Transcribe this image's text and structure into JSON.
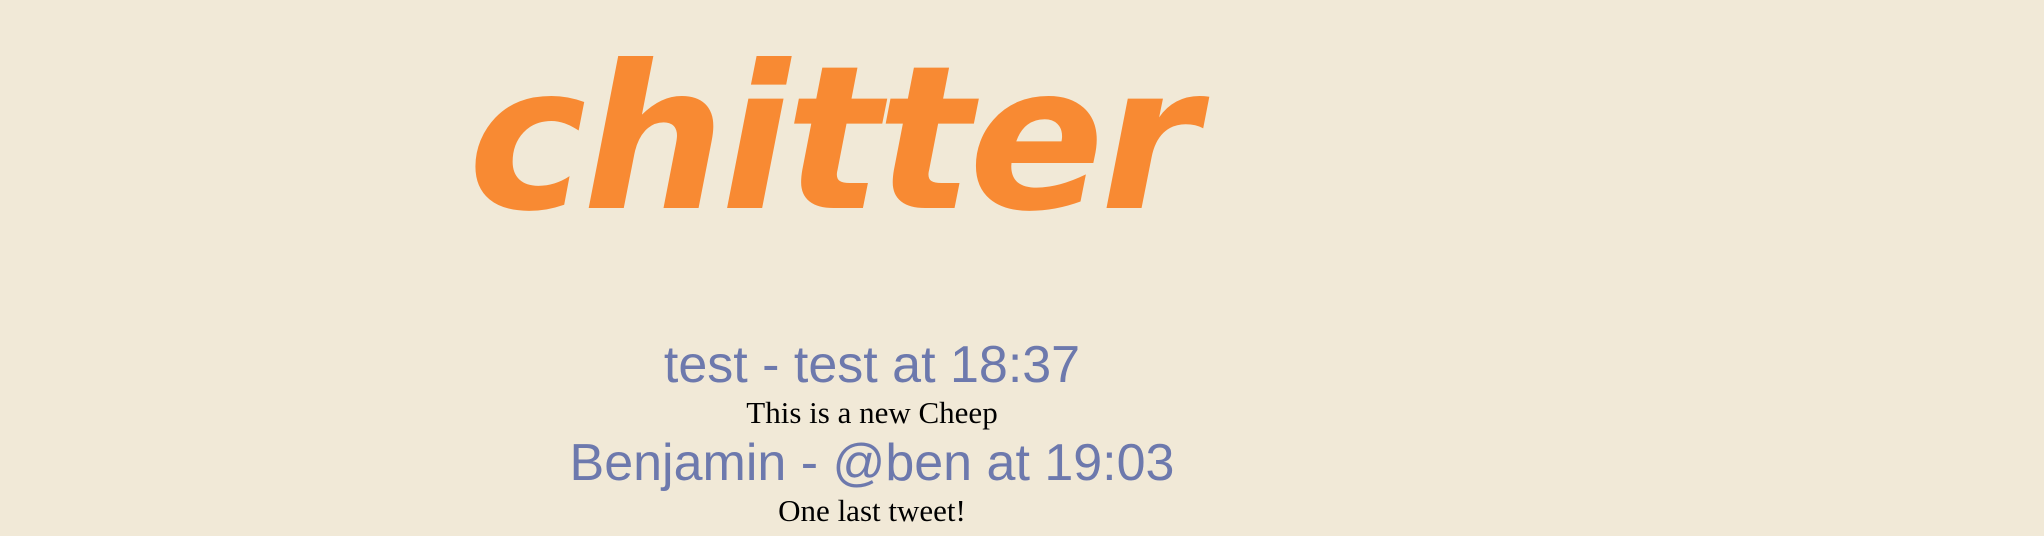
{
  "brand": {
    "logo_text": "chitter",
    "logo_color": "#f88a33"
  },
  "colors": {
    "background": "#f1e9d7",
    "header_text": "#6d79ad",
    "body_text": "#000000"
  },
  "cheeps": [
    {
      "header": "test - test at 18:37",
      "body": "This is a new Cheep"
    },
    {
      "header": "Benjamin - @ben at 19:03",
      "body": "One last tweet!"
    }
  ]
}
